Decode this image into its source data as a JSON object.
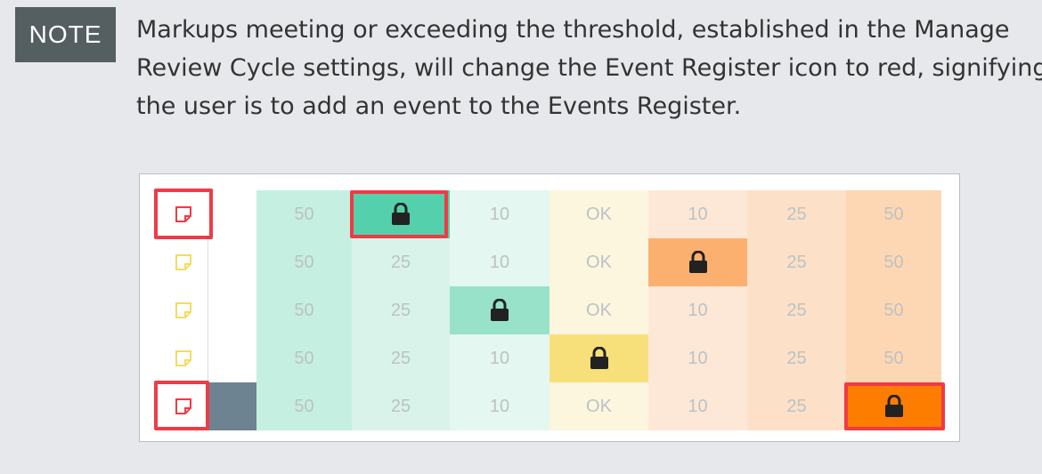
{
  "note": {
    "label": "NOTE",
    "lines": [
      "Markups meeting or exceeding the threshold, established in the Manage",
      "Review Cycle settings, will change the Event Register icon to red, signifying",
      "the user is to add an event to the Events Register."
    ]
  },
  "grid": {
    "rows": [
      {
        "icon": "red-note",
        "cells": [
          "50",
          "lock",
          "10",
          "OK",
          "10",
          "25",
          "50"
        ]
      },
      {
        "icon": "yellow-note",
        "cells": [
          "50",
          "25",
          "10",
          "OK",
          "lock",
          "25",
          "50"
        ]
      },
      {
        "icon": "yellow-note",
        "cells": [
          "50",
          "25",
          "lock",
          "OK",
          "10",
          "25",
          "50"
        ]
      },
      {
        "icon": "yellow-note",
        "cells": [
          "50",
          "25",
          "10",
          "lock",
          "10",
          "25",
          "50"
        ]
      },
      {
        "icon": "red-note",
        "cells": [
          "50",
          "25",
          "10",
          "OK",
          "10",
          "25",
          "lock"
        ]
      }
    ],
    "column_colors": [
      "#c5efe1",
      "#d9f3ea",
      "#e4f7f1",
      "#fcf6df",
      "#fde8d7",
      "#fde0c8",
      "#fdd7b3"
    ],
    "lock_colors": [
      "#54d0ac",
      "#fcb070",
      "#97e2c9",
      "#f7e07a",
      "#fd7d00"
    ],
    "red_icon_color": "#ef3b45",
    "yellow_icon_color": "#f3dc63",
    "highlight_color": "#ef3b45"
  }
}
